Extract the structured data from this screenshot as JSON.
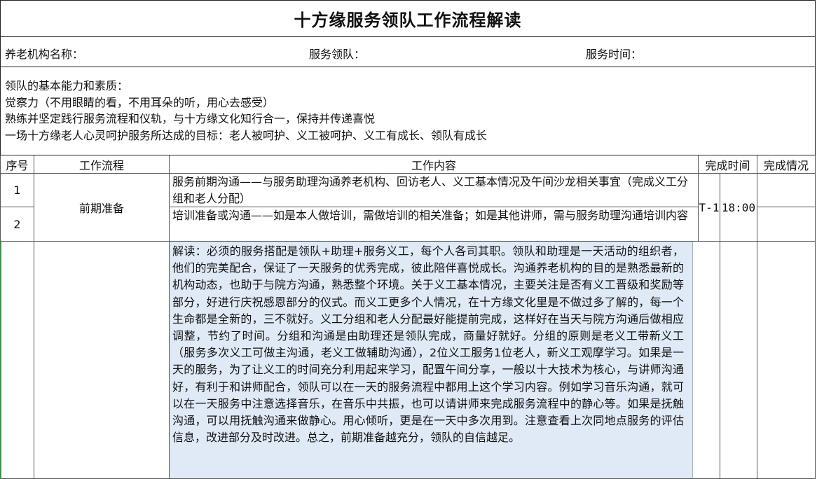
{
  "title": "十方缘服务领队工作流程解读",
  "info": {
    "org_label": "养老机构名称：",
    "leader_label": "服务领队：",
    "time_label": "服务时间："
  },
  "intro": {
    "heading": "领队的基本能力和素质：",
    "lines": [
      "觉察力（不用眼睛的看，不用耳朵的听，用心去感受）",
      "熟练并坚定践行服务流程和仪轨，与十方缘文化知行合一，保持并传递喜悦",
      "一场十方缘老人心灵呵护服务所达成的目标：老人被呵护、义工被呵护、义工有成长、领队有成长"
    ]
  },
  "table": {
    "headers": {
      "no": "序号",
      "process": "工作流程",
      "content": "工作内容",
      "time": "完成时间",
      "status": "完成情况"
    },
    "rows": [
      {
        "no": "1",
        "content": "服务前期沟通——与服务助理沟通养老机构、回访老人、义工基本情况及午间沙龙相关事宜（完成义工分组和老人分配）"
      },
      {
        "no": "2",
        "content": "培训准备或沟通——如是本人做培训，需做培训的相关准备；如是其他讲师，需与服务助理沟通培训内容"
      }
    ],
    "process": "前期准备",
    "time_day": "T-1",
    "time_clock": "18:00",
    "explanation": "解读：必须的服务搭配是领队+助理+服务义工，每个人各司其职。领队和助理是一天活动的组织者，他们的完美配合，保证了一天服务的优秀完成，彼此陪伴喜悦成长。沟通养老机构的目的是熟悉最新的机构动态，也助于与院方沟通，熟悉整个环境。关于义工基本情况，主要关注是否有义工晋级和奖励等部分，好进行庆祝感恩部分的仪式。而义工更多个人情况，在十方缘文化里是不做过多了解的，每一个生命都是全新的，三不就好。义工分组和老人分配最好能提前完成，这样好在当天与院方沟通后做相应调整，节约了时间。分组和沟通是由助理还是领队完成，商量好就好。分组的原则是老义工带新义工（服务多次义工可做主沟通，老义工做辅助沟通），2位义工服务1位老人，新义工观摩学习。如果是一天的服务，为了让义工的时间充分利用起来学习，配置午间分享，一般以十大技术为核心，与讲师沟通好，有利于和讲师配合，领队可以在一天的服务流程中都用上这个学习内容。例如学习音乐沟通，就可以在一天服务中注意选择音乐，在音乐中共振，也可以请讲师来完成服务流程中的静心等。如果是抚触沟通，可以用抚触沟通来做静心。用心倾听，更是在一天中多次用到。注意查看上次同地点服务的评估信息，改进部分及时改进。总之，前期准备越充分，领队的自信越足。"
  }
}
